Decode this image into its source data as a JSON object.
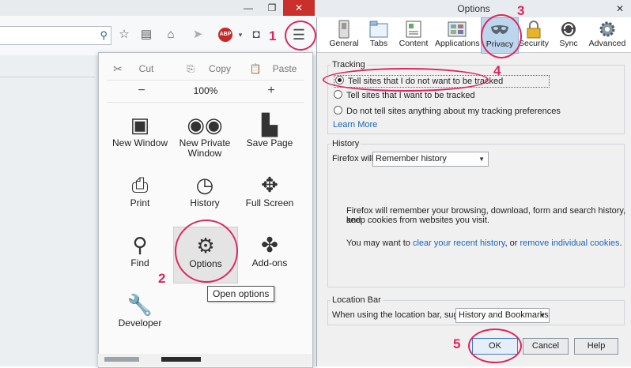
{
  "window": {
    "restore_glyph": "❐",
    "close_glyph": "✕",
    "minimize_glyph": "—"
  },
  "toolbar": {
    "abp_label": "ABP",
    "menu_icon": "hamburger-menu-icon"
  },
  "menu": {
    "edit": {
      "cut": "Cut",
      "copy": "Copy",
      "paste": "Paste"
    },
    "zoom": {
      "minus": "−",
      "value": "100%",
      "plus": "+"
    },
    "items": [
      {
        "label": "New Window"
      },
      {
        "label": "New Private\nWindow"
      },
      {
        "label": "Save Page"
      },
      {
        "label": "Print"
      },
      {
        "label": "History"
      },
      {
        "label": "Full Screen"
      },
      {
        "label": "Find"
      },
      {
        "label": "Options"
      },
      {
        "label": "Add-ons"
      },
      {
        "label": "Developer"
      }
    ],
    "tooltip": "Open options"
  },
  "annotations": {
    "n1": "1",
    "n2": "2",
    "n3": "3",
    "n4": "4",
    "n5": "5"
  },
  "dialog": {
    "title": "Options",
    "close": "✕",
    "tabs": [
      {
        "label": "General"
      },
      {
        "label": "Tabs"
      },
      {
        "label": "Content"
      },
      {
        "label": "Applications"
      },
      {
        "label": "Privacy"
      },
      {
        "label": "Security"
      },
      {
        "label": "Sync"
      },
      {
        "label": "Advanced"
      }
    ],
    "tracking": {
      "legend": "Tracking",
      "option1": "Tell sites that I do not want to be tracked",
      "option2": "Tell sites that I want to be tracked",
      "option3": "Do not tell sites anything about my tracking preferences",
      "learn_more": "Learn More"
    },
    "history": {
      "legend": "History",
      "will_label": "Firefox will:",
      "will_value": "Remember history",
      "desc1": "Firefox will remember your browsing, download, form and search history, and",
      "desc2": "keep cookies from websites you visit.",
      "may_prefix": "You may want to ",
      "clear_link": "clear your recent history",
      "or": ", or ",
      "remove_link": "remove individual cookies",
      "period": "."
    },
    "location": {
      "legend": "Location Bar",
      "suggest_label": "When using the location bar, suggest:",
      "suggest_value": "History and Bookmarks"
    },
    "buttons": {
      "ok": "OK",
      "cancel": "Cancel",
      "help": "Help"
    }
  }
}
